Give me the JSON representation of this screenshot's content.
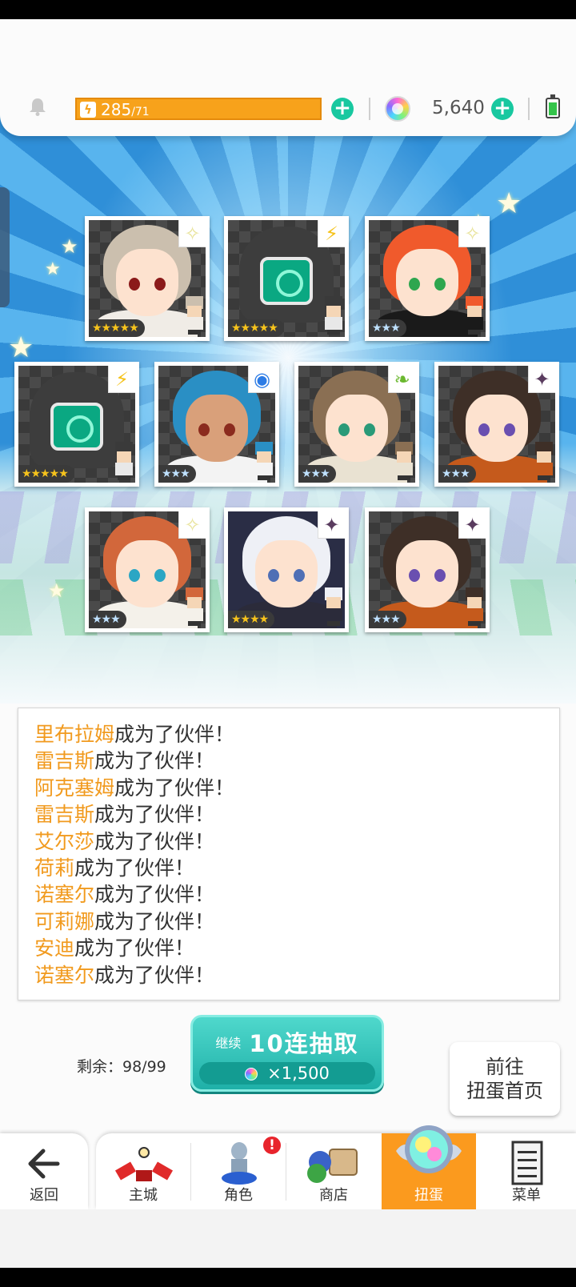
{
  "header": {
    "stamina_current": "285",
    "stamina_max": "/71",
    "gems": "5,640"
  },
  "cards": [
    {
      "element": "✧",
      "element_color": "#e8e39a",
      "stars": "★★★★★",
      "rarity": 5,
      "hair": "#cbbfae",
      "eye": "#8b1a1a",
      "outfit": "#f0ece6"
    },
    {
      "element": "⚡",
      "element_color": "#f5c21a",
      "stars": "★★★★★",
      "rarity": 5,
      "type": "robot"
    },
    {
      "element": "✧",
      "element_color": "#e8e39a",
      "stars": "★★★",
      "rarity": 3,
      "hair": "#f05a2c",
      "eye": "#2ea64f",
      "outfit": "#1a1a1a"
    },
    {
      "element": "⚡",
      "element_color": "#f5c21a",
      "stars": "★★★★★",
      "rarity": 5,
      "type": "robot"
    },
    {
      "element": "◉",
      "element_color": "#2c7be5",
      "stars": "★★★",
      "rarity": 3,
      "hair": "#2a8fc4",
      "eye": "#8b2b1e",
      "outfit": "#f3f3f3",
      "skin": "#d9a07a"
    },
    {
      "element": "❧",
      "element_color": "#6ab82e",
      "stars": "★★★",
      "rarity": 3,
      "hair": "#8a6f53",
      "eye": "#2a9a78",
      "outfit": "#e9e2d2"
    },
    {
      "element": "✦",
      "element_color": "#5a3c5f",
      "stars": "★★★",
      "rarity": 3,
      "hair": "#3e2f27",
      "eye": "#6a4fb0",
      "outfit": "#c55a1c"
    },
    {
      "element": "✧",
      "element_color": "#e8e39a",
      "stars": "★★★",
      "rarity": 3,
      "hair": "#d2673b",
      "eye": "#2ba6c4",
      "outfit": "#f4f1ea"
    },
    {
      "element": "✦",
      "element_color": "#5a3c5f",
      "stars": "★★★★",
      "rarity": 4,
      "hair": "#eef0f6",
      "eye": "#4f6fb5",
      "outfit": "#2b2b3a",
      "dark": true
    },
    {
      "element": "✦",
      "element_color": "#5a3c5f",
      "stars": "★★★",
      "rarity": 3,
      "hair": "#3e2f27",
      "eye": "#6a4fb0",
      "outfit": "#c55a1c"
    }
  ],
  "log": {
    "suffix": "成为了伙伴！",
    "names": [
      "里布拉姆",
      "雷吉斯",
      "阿克塞姆",
      "雷吉斯",
      "艾尔莎",
      "荷莉",
      "诺塞尔",
      "可莉娜",
      "安迪",
      "诺塞尔"
    ]
  },
  "draw": {
    "remaining": "剩余：98/99",
    "continue_label": "继续",
    "button_label": "10连抽取",
    "cost": "×1,500"
  },
  "goto": {
    "line1": "前往",
    "line2": "扭蛋首页"
  },
  "nav": {
    "back": "返回",
    "items": [
      {
        "label": "主城",
        "icon": "castle-icon"
      },
      {
        "label": "角色",
        "icon": "character-icon",
        "badge": "!"
      },
      {
        "label": "商店",
        "icon": "shop-icon"
      },
      {
        "label": "扭蛋",
        "icon": "gacha-icon",
        "active": true
      },
      {
        "label": "菜单",
        "icon": "menu-icon"
      }
    ]
  },
  "colors": {
    "accent": "#fb9a1e",
    "teal": "#1fb0a8",
    "stamina": "#f7a21b"
  }
}
